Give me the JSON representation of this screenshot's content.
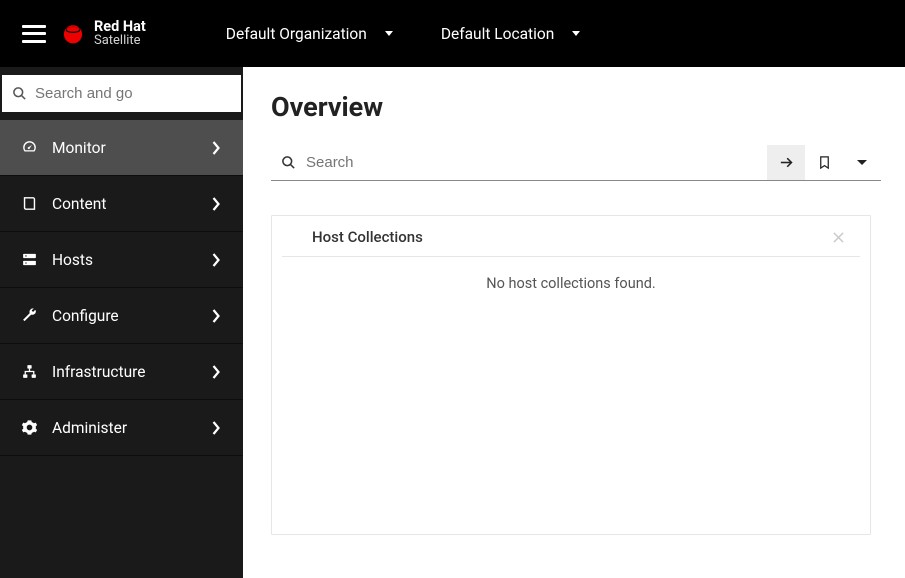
{
  "brand": {
    "line1": "Red Hat",
    "line2": "Satellite"
  },
  "topnav": {
    "org": "Default Organization",
    "loc": "Default Location"
  },
  "sidebar": {
    "search_placeholder": "Search and go",
    "items": [
      {
        "label": "Monitor"
      },
      {
        "label": "Content"
      },
      {
        "label": "Hosts"
      },
      {
        "label": "Configure"
      },
      {
        "label": "Infrastructure"
      },
      {
        "label": "Administer"
      }
    ]
  },
  "main": {
    "title": "Overview",
    "search_placeholder": "Search",
    "panel": {
      "title": "Host Collections",
      "empty": "No host collections found."
    }
  }
}
